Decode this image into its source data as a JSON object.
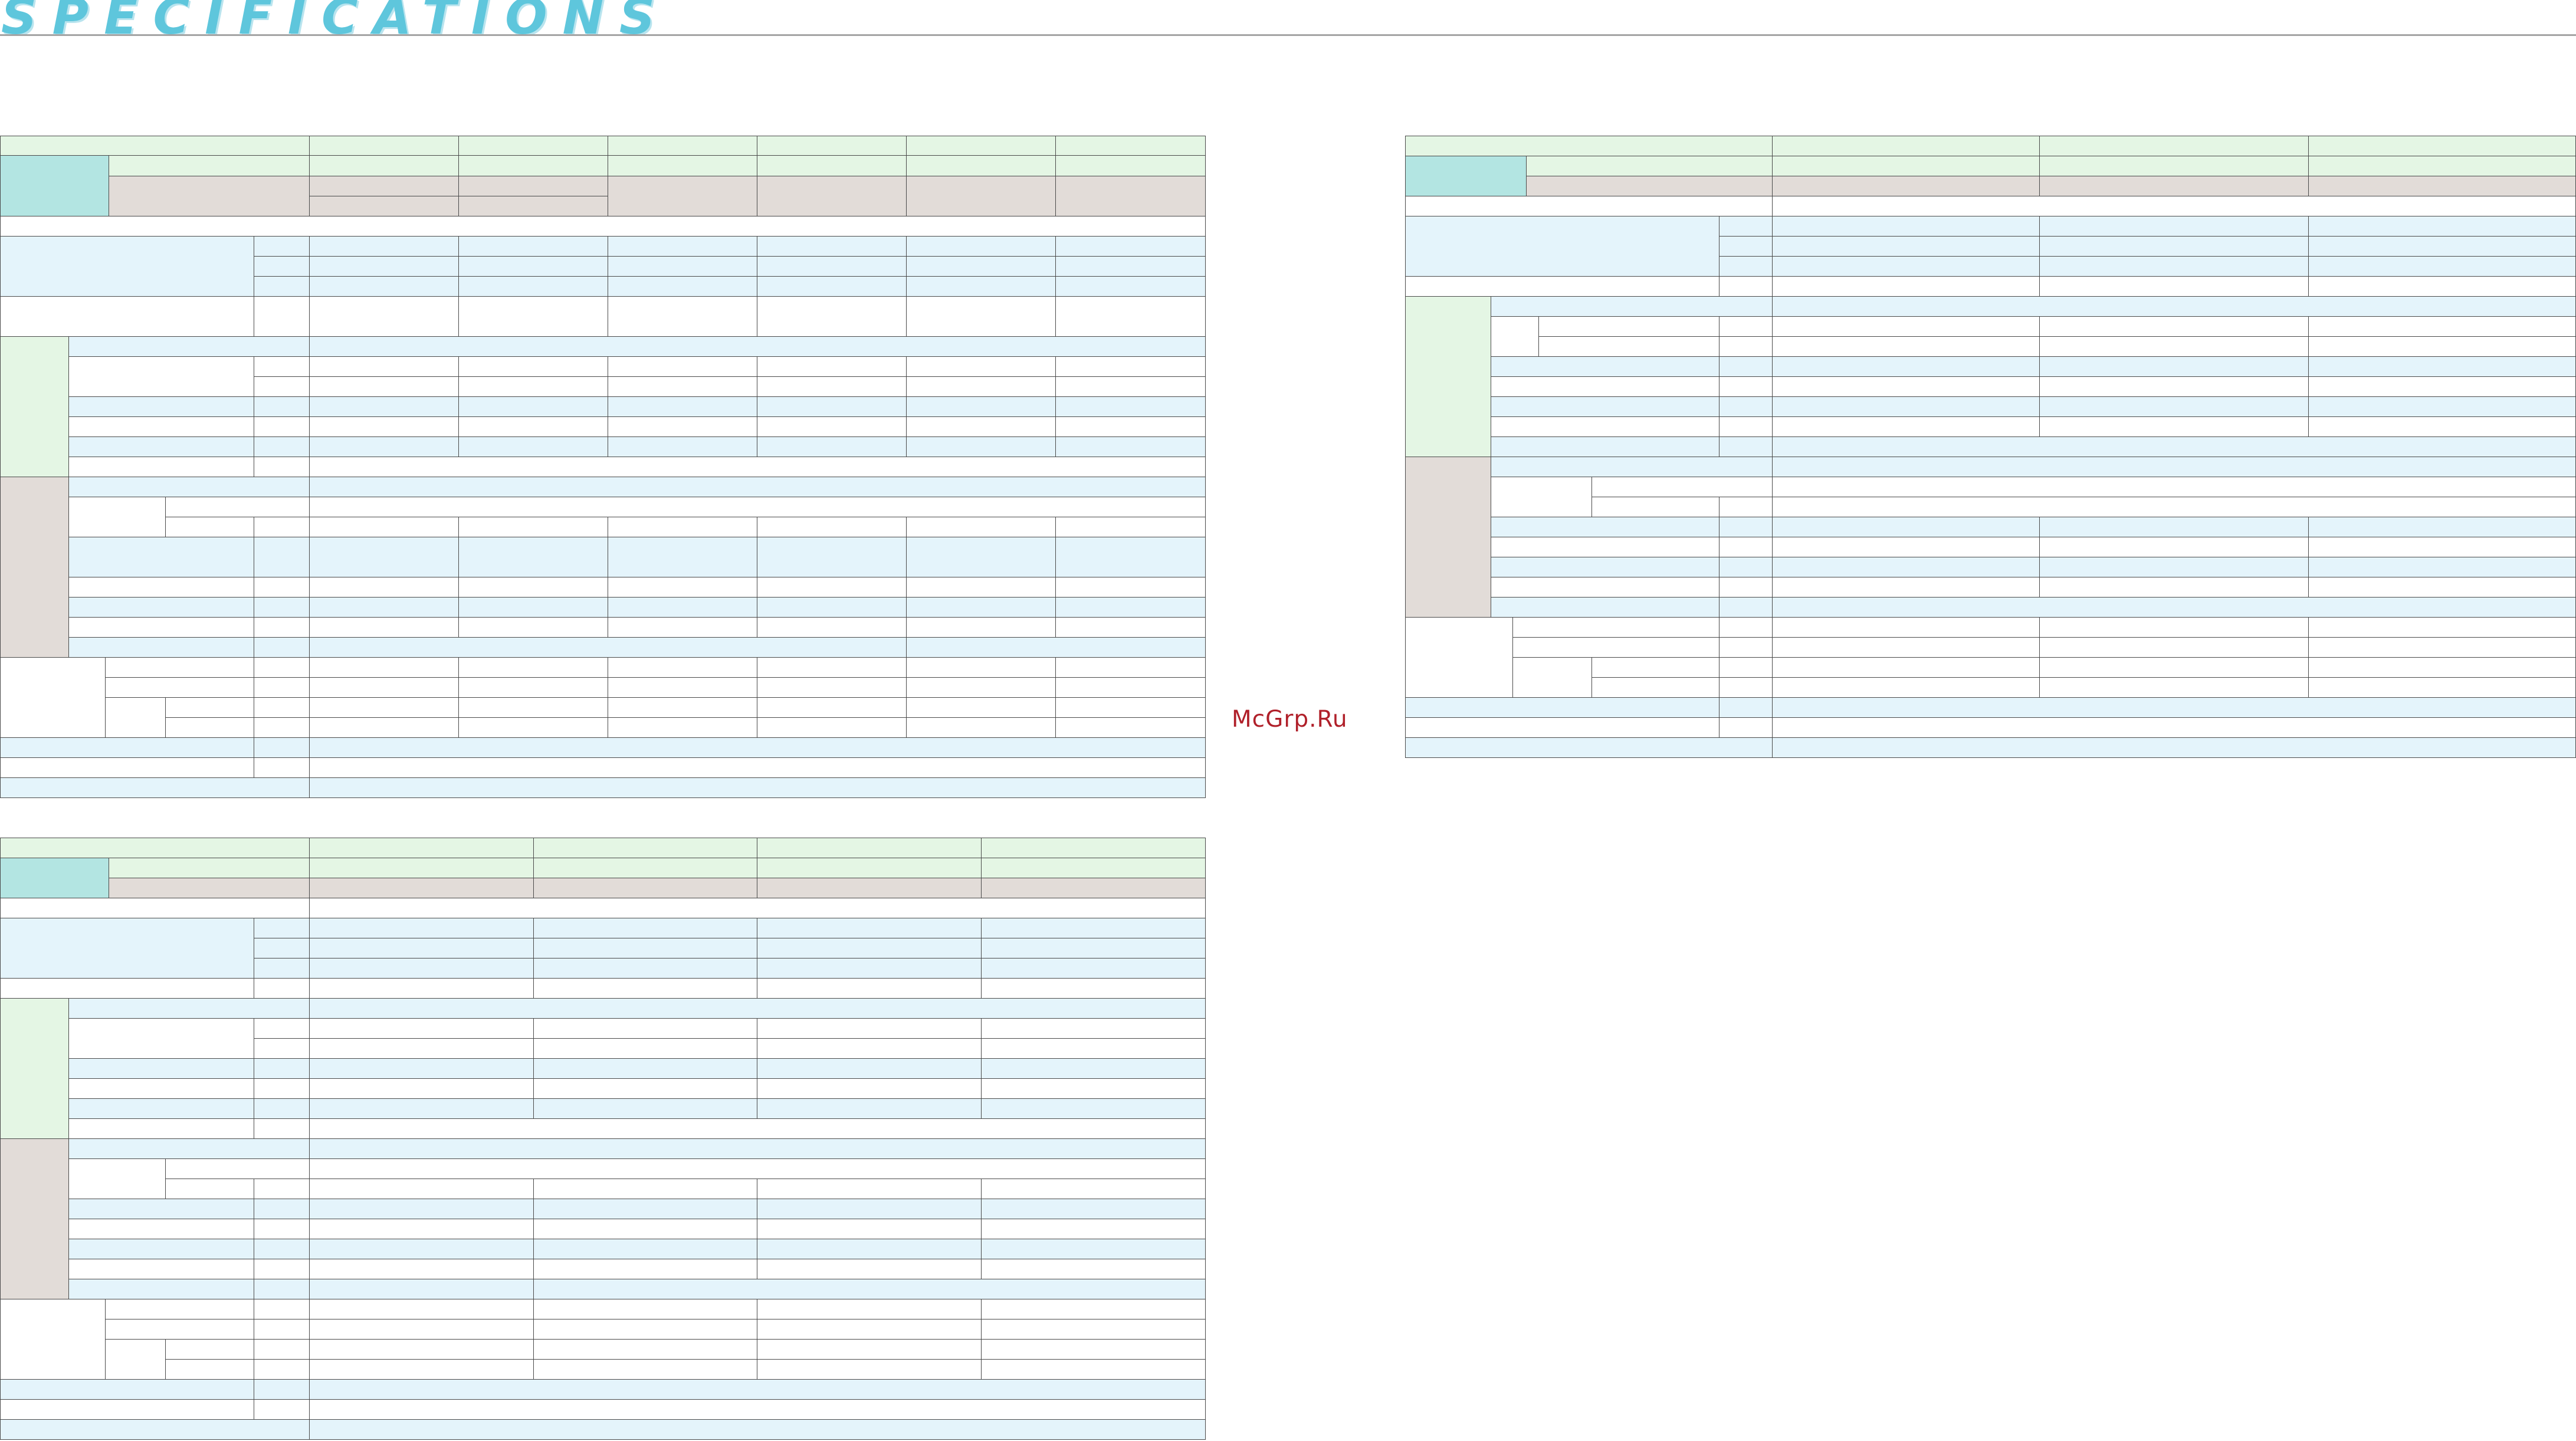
{
  "page": {
    "title": "SPECIFICATIONS",
    "watermark": "McGrp.Ru"
  },
  "colors": {
    "header_green": "#e4f6e4",
    "model_teal": "#b3e5e2",
    "row_light_blue": "#e4f4fb",
    "row_taupe": "#e2dcd8",
    "title_cyan": "#5ec6dc",
    "rule_gray": "#a4a4a4",
    "watermark_red": "#b0202a"
  }
}
